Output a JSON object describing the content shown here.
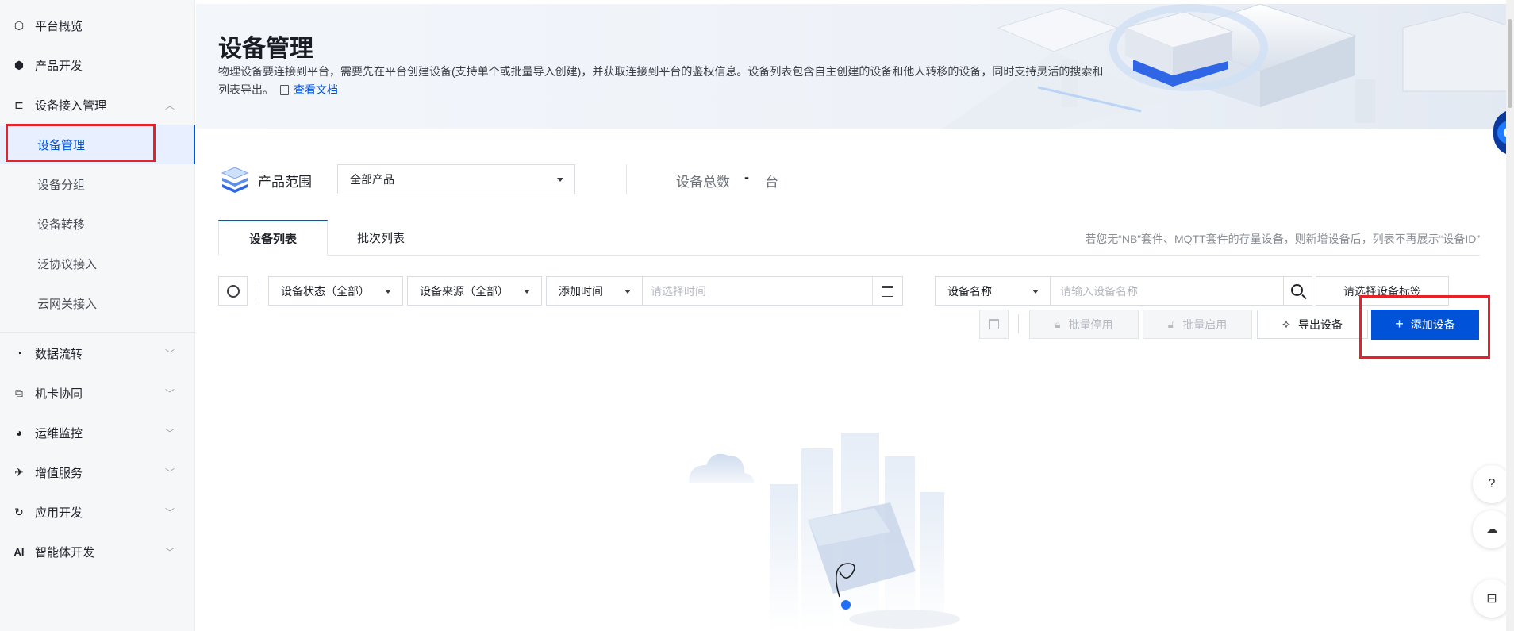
{
  "sidebar": {
    "items": [
      {
        "label": "平台概览",
        "icon": "overview-icon"
      },
      {
        "label": "产品开发",
        "icon": "cube-icon"
      },
      {
        "label": "设备接入管理",
        "icon": "device-access-icon",
        "expanded": true
      },
      {
        "label": "数据流转",
        "icon": "data-flow-icon"
      },
      {
        "label": "机卡协同",
        "icon": "card-sync-icon"
      },
      {
        "label": "运维监控",
        "icon": "monitor-icon"
      },
      {
        "label": "增值服务",
        "icon": "value-service-icon"
      },
      {
        "label": "应用开发",
        "icon": "app-dev-icon"
      },
      {
        "label": "智能体开发",
        "icon": "ai-icon"
      }
    ],
    "sub_items": [
      "设备管理",
      "设备分组",
      "设备转移",
      "泛协议接入",
      "云网关接入"
    ],
    "active_sub": "设备管理"
  },
  "header": {
    "title": "设备管理",
    "description": "物理设备要连接到平台，需要先在平台创建设备(支持单个或批量导入创建)，并获取连接到平台的鉴权信息。设备列表包含自主创建的设备和他人转移的设备，同时支持灵活的搜索和列表导出。",
    "doc_link": "查看文档"
  },
  "scope": {
    "label": "产品范围",
    "selected": "全部产品",
    "total_label": "设备总数",
    "total_value": "-",
    "total_unit": "台"
  },
  "tabs": [
    {
      "label": "设备列表",
      "active": true
    },
    {
      "label": "批次列表",
      "active": false
    }
  ],
  "tab_note": "若您无“NB”套件、MQTT套件的存量设备，则新增设备后，列表不再展示“设备ID”",
  "filters": {
    "status": "设备状态（全部）",
    "source": "设备来源（全部）",
    "time_field": "添加时间",
    "time_placeholder": "请选择时间",
    "name_field": "设备名称",
    "name_placeholder": "请输入设备名称",
    "tag_button": "请选择设备标签"
  },
  "actions": {
    "batch_disable": "批量停用",
    "batch_enable": "批量启用",
    "export": "导出设备",
    "add": "添加设备"
  },
  "colors": {
    "primary": "#0052d9",
    "highlight": "#e6212a",
    "accent_bar": "#6a3cf0"
  }
}
